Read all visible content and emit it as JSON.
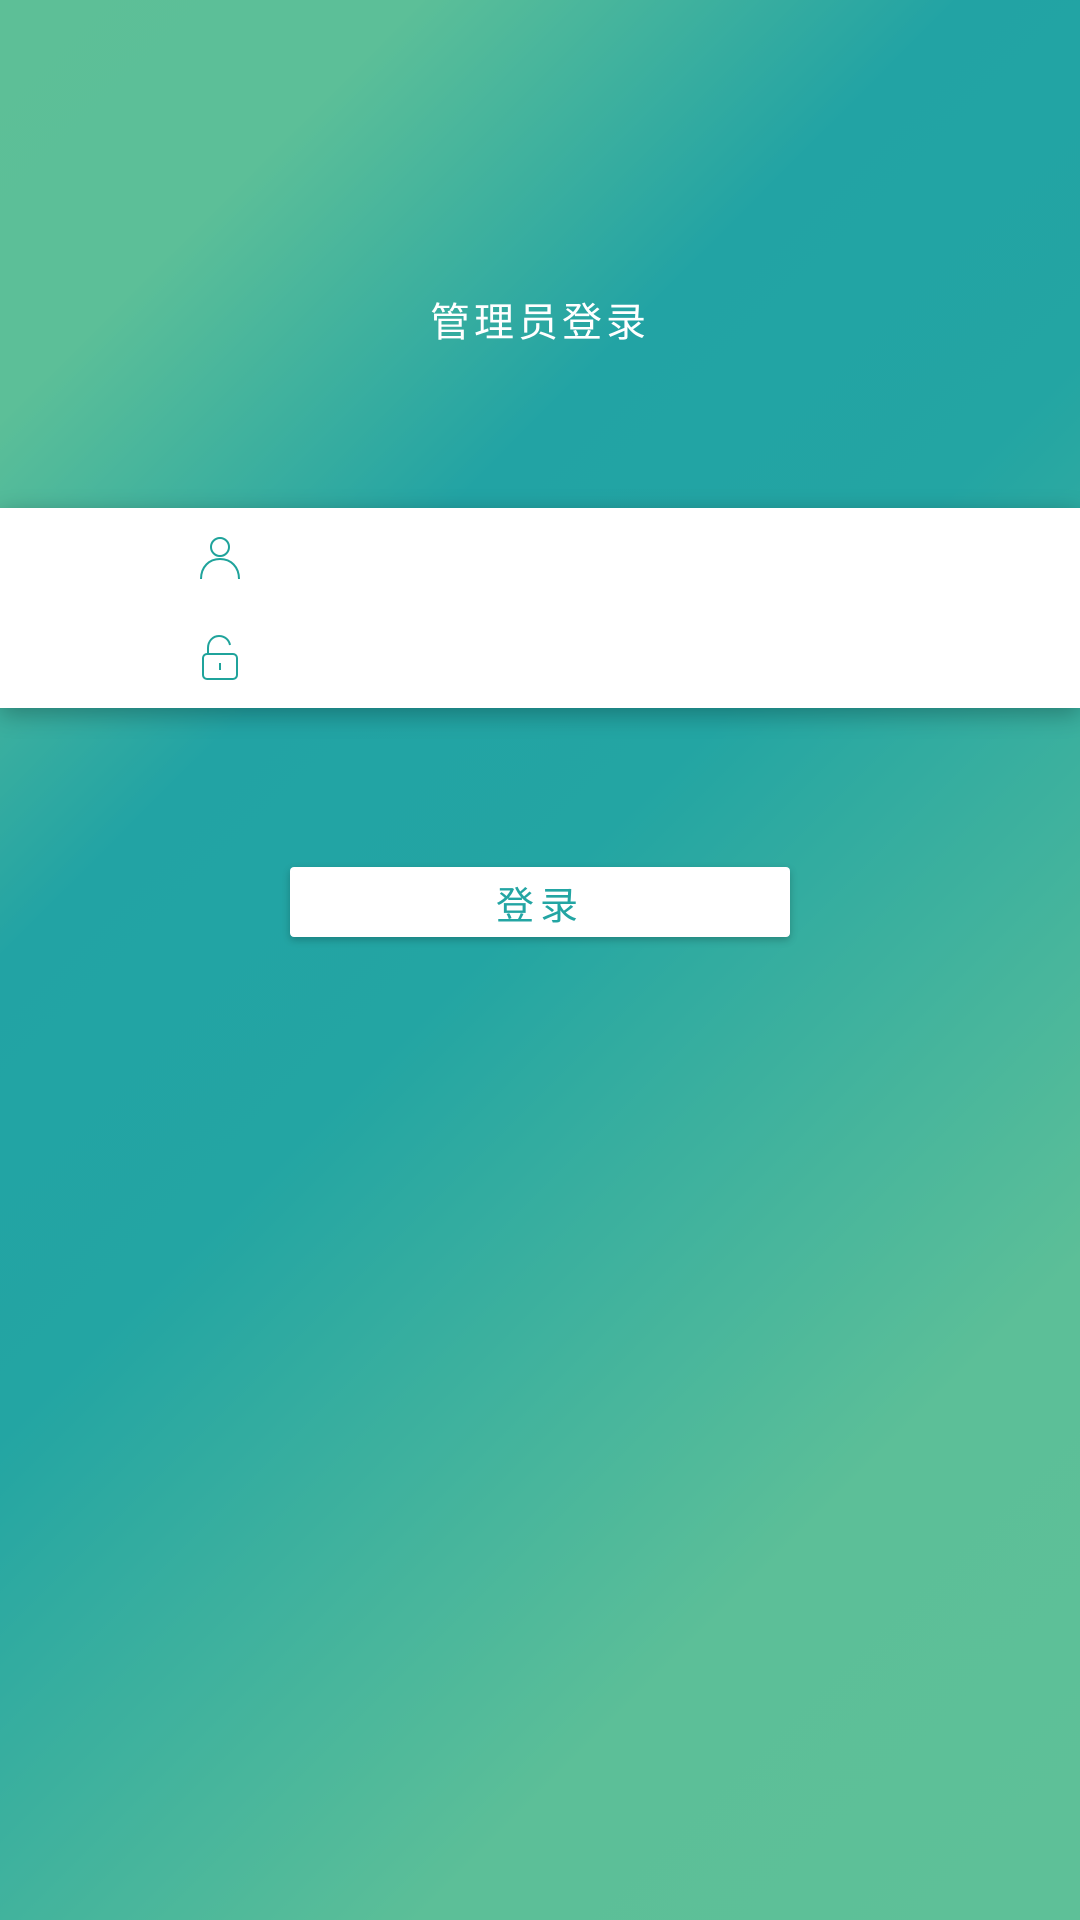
{
  "header": {
    "title": "管理员登录"
  },
  "form": {
    "username": {
      "value": "",
      "placeholder": "",
      "icon": "user-icon"
    },
    "password": {
      "value": "",
      "placeholder": "",
      "icon": "lock-icon"
    }
  },
  "actions": {
    "login_label": "登录"
  },
  "colors": {
    "accent": "#23a5a3",
    "gradient_light": "#5dbf97",
    "gradient_dark": "#22a3a4",
    "card_background": "#ffffff"
  }
}
